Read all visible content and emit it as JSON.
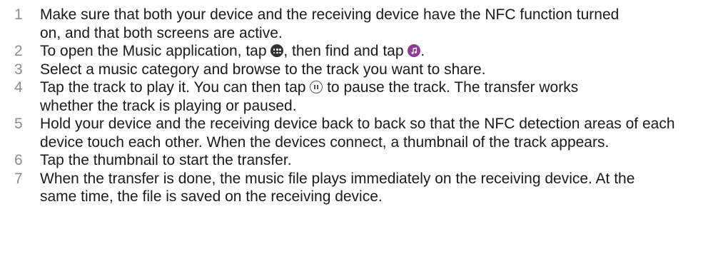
{
  "steps": [
    {
      "number": "1",
      "text": "Make sure that both your device and the receiving device have the NFC function turned on, and that both screens are active."
    },
    {
      "number": "2",
      "text_before_apps": "To open the Music application, tap ",
      "text_between": ", then find and tap ",
      "text_after": ".",
      "apps_icon": "apps-grid-icon",
      "music_icon": "music-note-icon",
      "music_icon_color": "#8e3b93"
    },
    {
      "number": "3",
      "text": "Select a music category and browse to the track you want to share."
    },
    {
      "number": "4",
      "text_before": "Tap the track to play it. You can then tap ",
      "text_after": " to pause the track. The transfer works whether the track is playing or paused.",
      "pause_icon": "pause-icon"
    },
    {
      "number": "5",
      "text": "Hold your device and the receiving device back to back so that the NFC detection areas of each device touch each other. When the devices connect, a thumbnail of the track appears."
    },
    {
      "number": "6",
      "text": "Tap the thumbnail to start the transfer."
    },
    {
      "number": "7",
      "text": "When the transfer is done, the music file plays immediately on the receiving device. At the same time, the file is saved on the receiving device."
    }
  ]
}
